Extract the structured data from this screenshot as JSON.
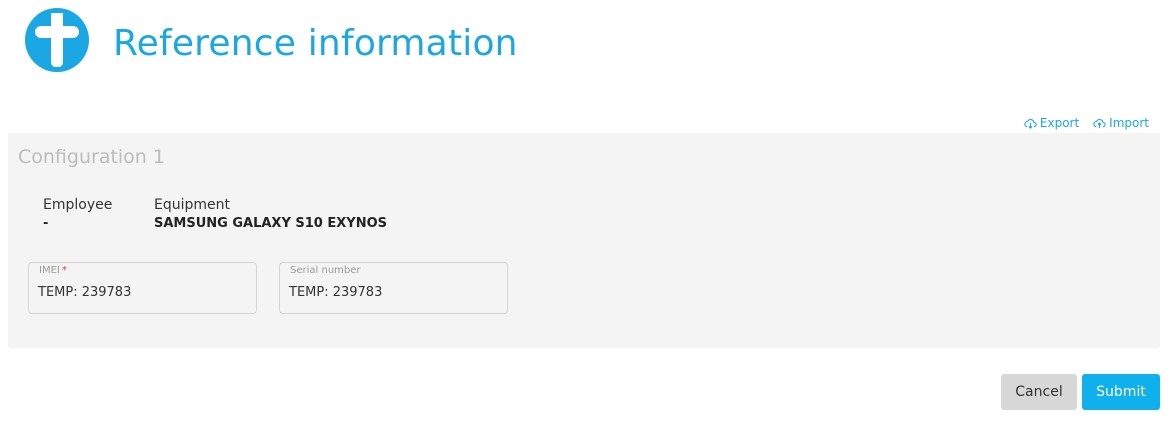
{
  "header": {
    "title": "Reference information",
    "logo_icon": "cross-logo-icon",
    "accent_color": "#1aa7e4"
  },
  "toolbar": {
    "export_label": "Export",
    "import_label": "Import"
  },
  "config": {
    "title": "Configuration 1",
    "employee_label": "Employee",
    "employee_value": "-",
    "equipment_label": "Equipment",
    "equipment_value": "SAMSUNG GALAXY S10 EXYNOS",
    "imei": {
      "label": "IMEI",
      "required_mark": "*",
      "value": "TEMP: 239783"
    },
    "serial": {
      "label": "Serial number",
      "value": "TEMP: 239783"
    }
  },
  "buttons": {
    "cancel_label": "Cancel",
    "submit_label": "Submit",
    "submit_color": "#10b0ec"
  }
}
